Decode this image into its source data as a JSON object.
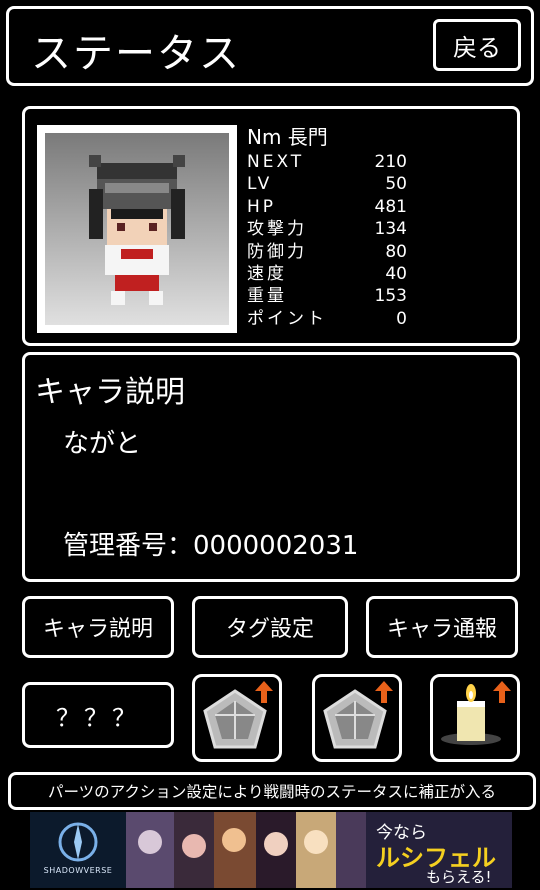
{
  "header": {
    "title": "ステータス",
    "back_label": "戻る"
  },
  "character": {
    "name": "Nm 長門",
    "stats": [
      {
        "label": "NEXT",
        "value": "210"
      },
      {
        "label": "LV",
        "value": "50"
      },
      {
        "label": "HP",
        "value": "481"
      },
      {
        "label": "攻撃力",
        "value": "134"
      },
      {
        "label": "防御力",
        "value": "80"
      },
      {
        "label": "速度",
        "value": "40"
      },
      {
        "label": "重量",
        "value": "153"
      },
      {
        "label": "ポイント",
        "value": "0"
      }
    ]
  },
  "description": {
    "title": "キャラ説明",
    "text": "ながと",
    "management": "管理番号：0000002031"
  },
  "actions": {
    "char_desc": "キャラ説明",
    "tag_settings": "タグ設定",
    "char_report": "キャラ通報",
    "unknown": "？？？"
  },
  "notice": "パーツのアクション設定により戦闘時のステータスに補正が入る",
  "banner": {
    "logo": "SHADOWVERSE",
    "cta_line1": "今なら",
    "cta_line2": "ルシフェル",
    "cta_line3": "もらえる!"
  },
  "colors": {
    "arrow": "#e8611a",
    "background": "#000000",
    "border": "#ffffff"
  }
}
